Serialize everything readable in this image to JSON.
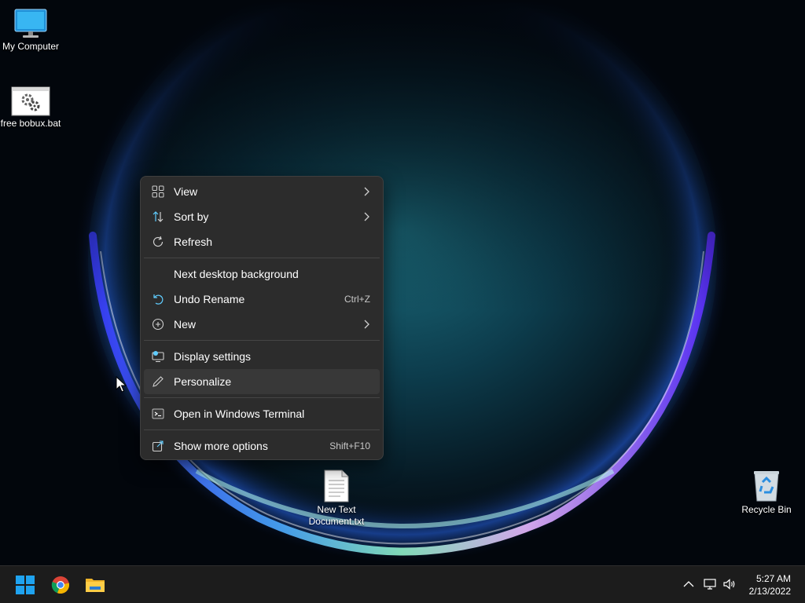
{
  "desktop": {
    "icons": [
      {
        "label": "My Computer",
        "icon": "monitor-icon"
      },
      {
        "label": "free bobux.bat",
        "icon": "batch-file-icon"
      },
      {
        "label": "New Text Document.txt",
        "icon": "text-file-icon"
      },
      {
        "label": "Recycle Bin",
        "icon": "recycle-bin-icon"
      }
    ]
  },
  "context_menu": {
    "view": {
      "label": "View",
      "icon": "grid-view-icon"
    },
    "sort_by": {
      "label": "Sort by",
      "icon": "sort-arrows-icon"
    },
    "refresh": {
      "label": "Refresh",
      "icon": "refresh-icon"
    },
    "next_background": {
      "label": "Next desktop background"
    },
    "undo_rename": {
      "label": "Undo Rename",
      "shortcut": "Ctrl+Z",
      "icon": "undo-icon"
    },
    "new": {
      "label": "New",
      "icon": "plus-circle-icon"
    },
    "display_settings": {
      "label": "Display settings",
      "icon": "display-settings-icon"
    },
    "personalize": {
      "label": "Personalize",
      "icon": "pen-icon"
    },
    "open_terminal": {
      "label": "Open in Windows Terminal",
      "icon": "terminal-icon"
    },
    "show_more": {
      "label": "Show more options",
      "shortcut": "Shift+F10",
      "icon": "share-icon"
    }
  },
  "taskbar": {
    "pinned": [
      {
        "name": "start",
        "icon": "windows-logo-icon"
      },
      {
        "name": "chrome",
        "icon": "chrome-icon"
      },
      {
        "name": "file-explorer",
        "icon": "folder-icon"
      }
    ],
    "tray": [
      "chevron-up-icon",
      "network-icon",
      "volume-icon"
    ],
    "clock": {
      "time": "5:27 AM",
      "date": "2/13/2022"
    }
  },
  "colors": {
    "menu_bg": "#2c2c2c",
    "menu_hover": "#383838",
    "taskbar_bg": "#1c1c1c",
    "accent": "#60cdff"
  }
}
